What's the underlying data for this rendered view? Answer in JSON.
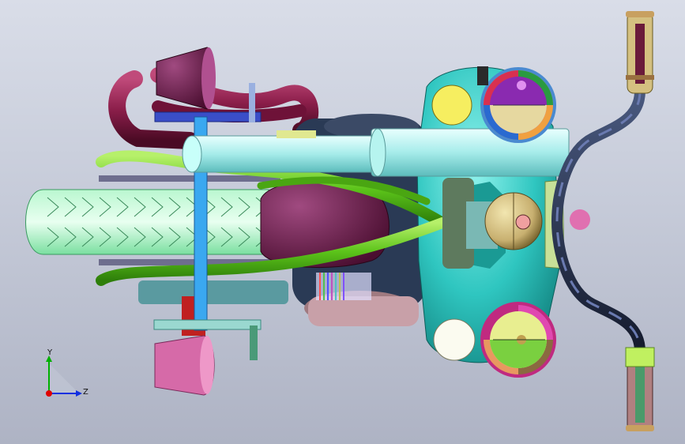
{
  "view": {
    "axes": {
      "y_label": "Y",
      "z_label": "Z"
    },
    "colors": {
      "background_top": "#d9dde8",
      "background_bottom": "#aeb3c4",
      "tank": "#2fc6c0",
      "tube_light": "#b8f5f2",
      "frame_green": "#5cc41a",
      "tire": "#8ff0b8",
      "exhaust": "#8b1e4a",
      "handlebar": "#2b3550",
      "gauge_purple": "#8a2ab0",
      "gauge_tan": "#e6d8a0",
      "cylinder_tan": "#c8b070",
      "grip_tan": "#c8a860",
      "pink_block": "#d66aa8",
      "plum_block": "#6a1a4a"
    },
    "axis_colors": {
      "x": "#e00000",
      "y": "#00b000",
      "z": "#1030e0"
    }
  }
}
